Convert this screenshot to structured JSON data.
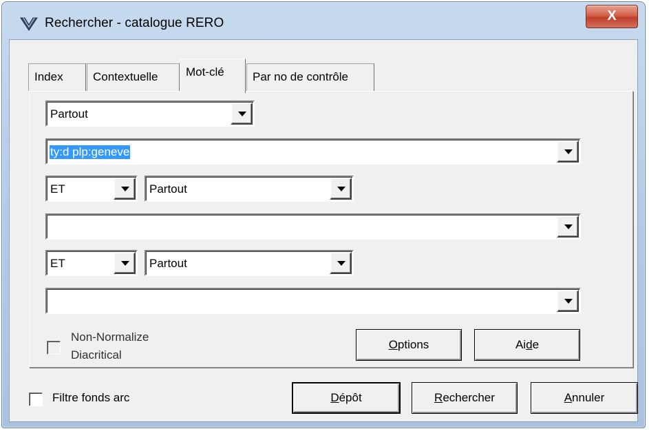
{
  "window": {
    "title": "Rechercher - catalogue RERO",
    "close_label": "X"
  },
  "tabs": [
    {
      "label": "Index"
    },
    {
      "label": "Contextuelle"
    },
    {
      "label": "Mot-clé",
      "active": true
    },
    {
      "label": "Par no de contrôle"
    }
  ],
  "search": {
    "field1_scope": "Partout",
    "term1_value": "ty:d plp:geneve",
    "row2_operator": "ET",
    "row2_scope": "Partout",
    "term2_value": "",
    "row3_operator": "ET",
    "row3_scope": "Partout",
    "term3_value": ""
  },
  "non_normalize": {
    "line1": "Non-Normalize",
    "line2": "Diacritical",
    "checked": false,
    "enabled": false
  },
  "panel_buttons": {
    "options": {
      "pre": "",
      "mnemonic": "O",
      "post": "ptions"
    },
    "aide": {
      "pre": "Ai",
      "mnemonic": "d",
      "post": "e"
    }
  },
  "filtre": {
    "label": "Filtre fonds arc",
    "checked": false
  },
  "bottom_buttons": {
    "depot": {
      "pre": "",
      "mnemonic": "D",
      "post": "épôt"
    },
    "rechercher": {
      "pre": "",
      "mnemonic": "R",
      "post": "echercher"
    },
    "annuler": {
      "pre": "",
      "mnemonic": "A",
      "post": "nnuler"
    }
  }
}
